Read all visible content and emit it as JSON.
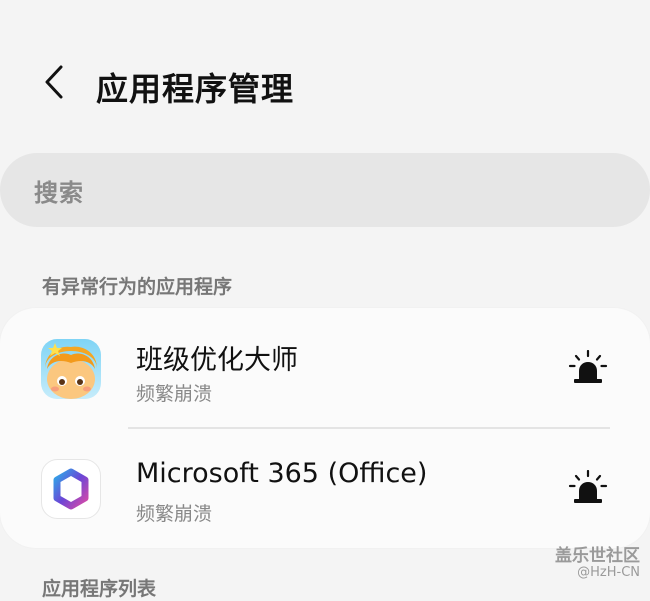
{
  "header": {
    "title": "应用程序管理",
    "back_icon": "chevron-left-icon"
  },
  "search": {
    "placeholder": "搜索"
  },
  "sections": {
    "abnormal_label": "有异常行为的应用程序",
    "list_label": "应用程序列表"
  },
  "apps": [
    {
      "name": "班级优化大师",
      "status": "频繁崩溃",
      "icon": "class-optimizer-app-icon",
      "action_icon": "alert-siren-icon"
    },
    {
      "name": "Microsoft 365 (Office)",
      "status": "频繁崩溃",
      "icon": "microsoft-365-app-icon",
      "action_icon": "alert-siren-icon"
    }
  ],
  "watermark": {
    "main": "盖乐世社区",
    "sub": "@HzH-CN"
  }
}
